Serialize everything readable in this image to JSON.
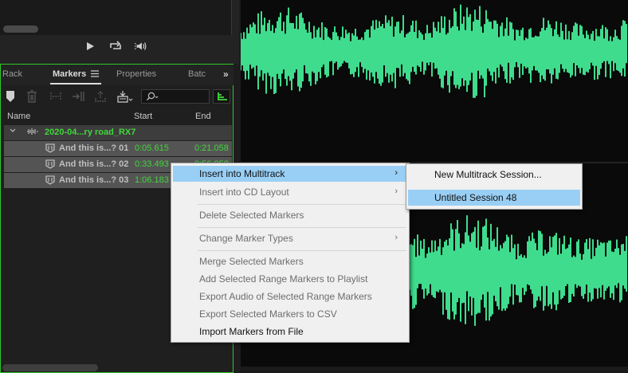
{
  "panel": {
    "tabs": [
      {
        "label": "Rack"
      },
      {
        "label": "Markers",
        "active": true
      },
      {
        "label": "Properties"
      },
      {
        "label": "Batc"
      }
    ],
    "columns": {
      "name": "Name",
      "start": "Start",
      "end": "End"
    },
    "group": {
      "name": "2020-04...ry road_RX7"
    },
    "markers": [
      {
        "name": "And this is...? 01",
        "start": "0:05.615",
        "end": "0:21.058"
      },
      {
        "name": "And this is...? 02",
        "start": "0:33.493",
        "end": "0:56.858"
      },
      {
        "name": "And this is...? 03",
        "start": "1:06.183",
        "end": ""
      }
    ],
    "search_placeholder": ""
  },
  "context_menu": {
    "items": [
      {
        "label": "Insert into Multitrack",
        "enabled": true,
        "highlighted": true,
        "submenu": true
      },
      {
        "label": "Insert into CD Layout",
        "enabled": false,
        "submenu": true
      },
      {
        "label": "Delete Selected Markers",
        "enabled": false
      },
      {
        "label": "Change Marker Types",
        "enabled": false,
        "submenu": true
      },
      {
        "label": "Merge Selected Markers",
        "enabled": false
      },
      {
        "label": "Add Selected Range Markers to Playlist",
        "enabled": false
      },
      {
        "label": "Export Audio of Selected Range Markers",
        "enabled": false
      },
      {
        "label": "Export Selected Markers to CSV",
        "enabled": false
      },
      {
        "label": "Import Markers from File",
        "enabled": true
      }
    ]
  },
  "submenu": {
    "items": [
      {
        "label": "New Multitrack Session...",
        "highlighted": false
      },
      {
        "label": "Untitled Session 48",
        "highlighted": true
      }
    ]
  },
  "colors": {
    "waveform": "#3fdc8e",
    "panel_focus": "#31c62b",
    "time_green": "#41d63a",
    "menu_highlight": "#99cff5"
  },
  "icons": {
    "submenu_arrow": "›",
    "more": "»"
  }
}
